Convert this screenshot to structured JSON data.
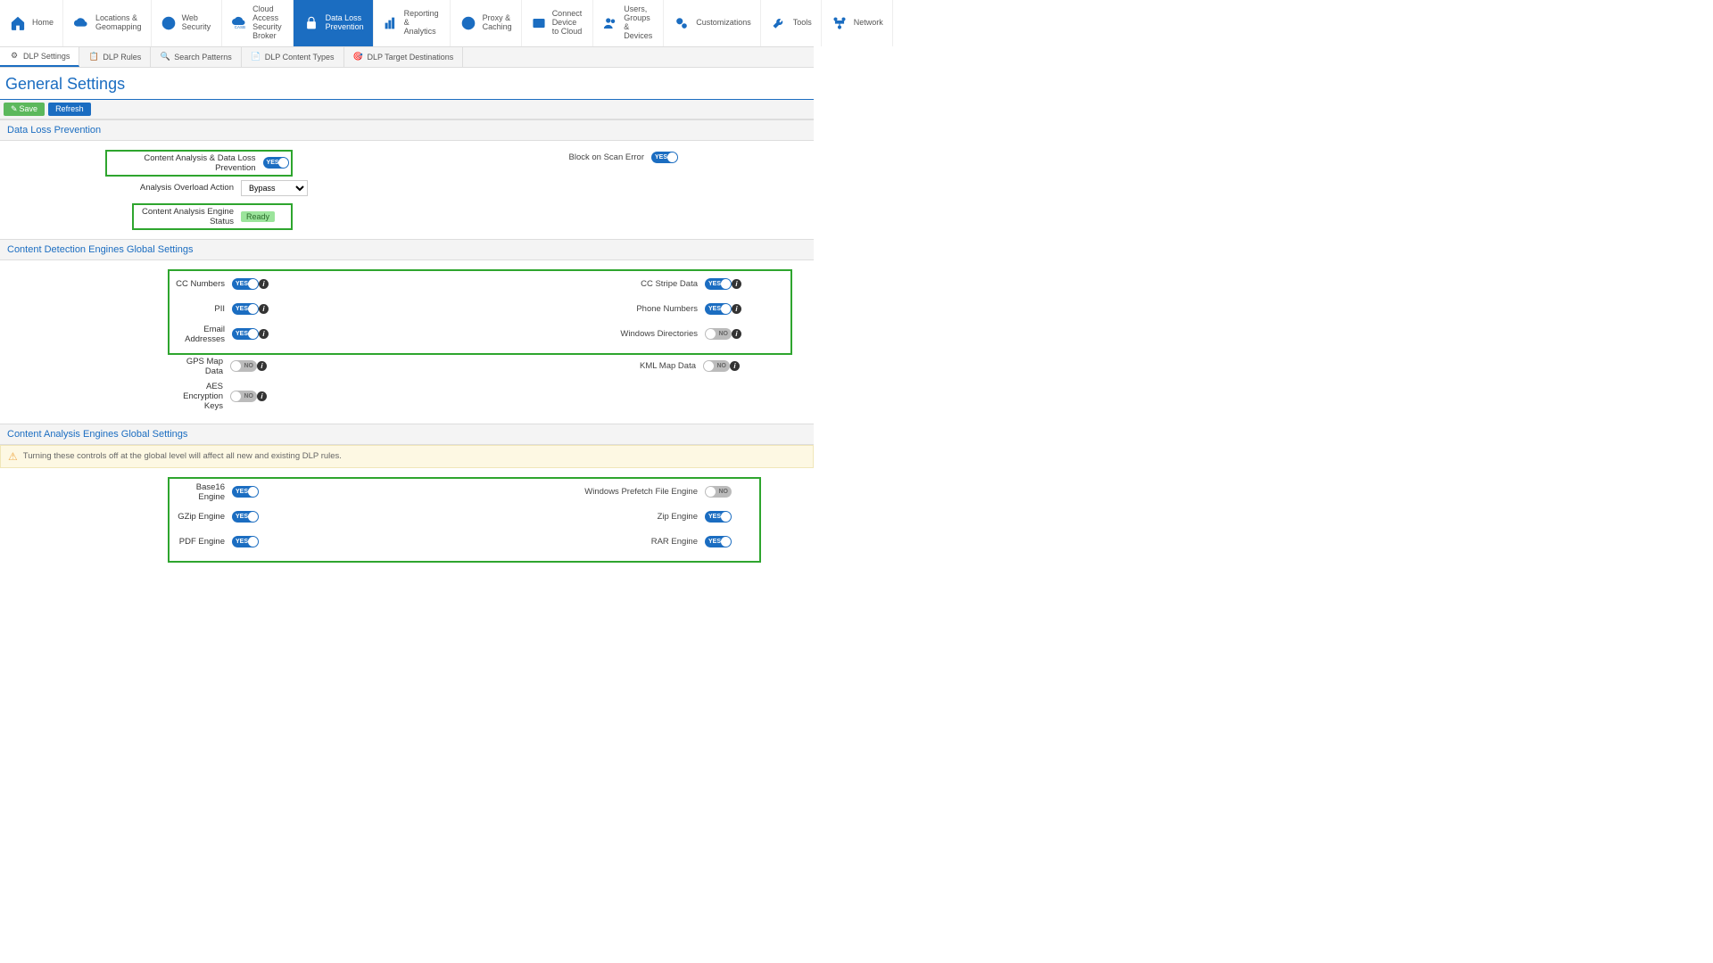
{
  "nav": {
    "items": [
      {
        "label": "Home"
      },
      {
        "label": "Locations &\nGeomapping"
      },
      {
        "label": "Web Security"
      },
      {
        "label": "Cloud Access\nSecurity Broker"
      },
      {
        "label": "Data Loss\nPrevention"
      },
      {
        "label": "Reporting &\nAnalytics"
      },
      {
        "label": "Proxy &\nCaching"
      },
      {
        "label": "Connect Device\nto Cloud"
      },
      {
        "label": "Users, Groups\n& Devices"
      },
      {
        "label": "Customizations"
      },
      {
        "label": "Tools"
      },
      {
        "label": "Network"
      }
    ]
  },
  "subnav": {
    "items": [
      "DLP Settings",
      "DLP Rules",
      "Search Patterns",
      "DLP Content Types",
      "DLP Target Destinations"
    ]
  },
  "page_title": "General Settings",
  "actions": {
    "save": "Save",
    "refresh": "Refresh"
  },
  "section1": {
    "title": "Data Loss Prevention",
    "content_analysis_label": "Content Analysis & Data Loss Prevention",
    "block_scan_error_label": "Block on Scan Error",
    "overload_label": "Analysis Overload Action",
    "overload_value": "Bypass",
    "engine_status_label": "Content Analysis Engine Status",
    "engine_status_value": "Ready"
  },
  "section2": {
    "title": "Content Detection Engines Global Settings",
    "rows": {
      "cc_numbers": "CC Numbers",
      "cc_stripe": "CC Stripe Data",
      "pii": "PII",
      "phone": "Phone Numbers",
      "email": "Email Addresses",
      "windows_dir": "Windows Directories",
      "gps": "GPS Map Data",
      "kml": "KML Map Data",
      "aes": "AES Encryption Keys"
    }
  },
  "section3": {
    "title": "Content Analysis Engines Global Settings",
    "warning": "Turning these controls off at the global level will affect all new and existing DLP rules.",
    "rows": {
      "base16": "Base16 Engine",
      "prefetch": "Windows Prefetch File Engine",
      "gzip": "GZip Engine",
      "zip": "Zip Engine",
      "pdf": "PDF Engine",
      "rar": "RAR Engine"
    }
  },
  "toggle": {
    "yes": "YES",
    "no": "NO"
  }
}
